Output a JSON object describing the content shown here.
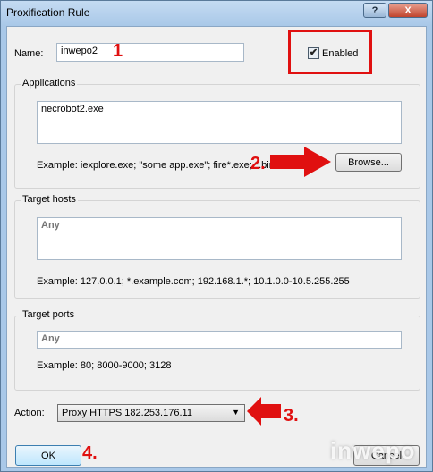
{
  "window": {
    "title": "Proxification Rule",
    "help_button": "?",
    "close_button": "X"
  },
  "name": {
    "label": "Name:",
    "value": "inwepo2"
  },
  "enabled": {
    "label": "Enabled",
    "checked": true
  },
  "applications": {
    "group_title": "Applications",
    "value": "necrobot2.exe",
    "example": "Example: iexplore.exe; \"some app.exe\"; fire*.exe; *.bin",
    "browse_button": "Browse..."
  },
  "target_hosts": {
    "group_title": "Target hosts",
    "value": "Any",
    "example": "Example: 127.0.0.1; *.example.com; 192.168.1.*; 10.1.0.0-10.5.255.255"
  },
  "target_ports": {
    "group_title": "Target ports",
    "value": "Any",
    "example": "Example: 80; 8000-9000; 3128"
  },
  "action": {
    "label": "Action:",
    "selected": "Proxy HTTPS 182.253.176.11"
  },
  "buttons": {
    "ok": "OK",
    "cancel": "Cancel"
  },
  "annotations": {
    "step1": "1",
    "step2": "2.",
    "step3": "3.",
    "step4": "4.",
    "color": "#e01010"
  },
  "watermark": "inwepo"
}
